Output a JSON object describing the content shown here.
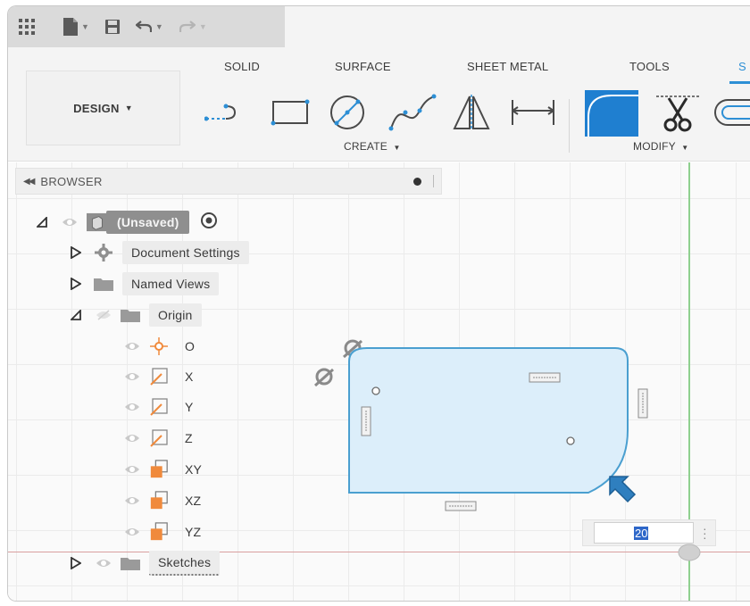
{
  "ribbon": {
    "design_label": "DESIGN",
    "tabs": [
      "SOLID",
      "SURFACE",
      "SHEET METAL",
      "TOOLS",
      "S"
    ],
    "groups": {
      "create": "CREATE",
      "modify": "MODIFY"
    }
  },
  "browser": {
    "title": "BROWSER",
    "root": "(Unsaved)",
    "document_settings": "Document Settings",
    "named_views": "Named Views",
    "origin": "Origin",
    "origin_items": [
      "O",
      "X",
      "Y",
      "Z",
      "XY",
      "XZ",
      "YZ"
    ],
    "sketches": "Sketches"
  },
  "dimension_input": {
    "value": "20"
  },
  "colors": {
    "accent": "#2d8fd5",
    "sketch_fill": "#dceefa",
    "sketch_stroke": "#4a9fd0",
    "plane_orange": "#f08a3c",
    "axis_green": "#8fd08f",
    "axis_red": "#d9a0a0"
  },
  "icons": {
    "app_menu": "grid-icon",
    "file": "file-icon",
    "save": "save-icon",
    "undo": "undo-icon",
    "redo": "redo-icon"
  }
}
